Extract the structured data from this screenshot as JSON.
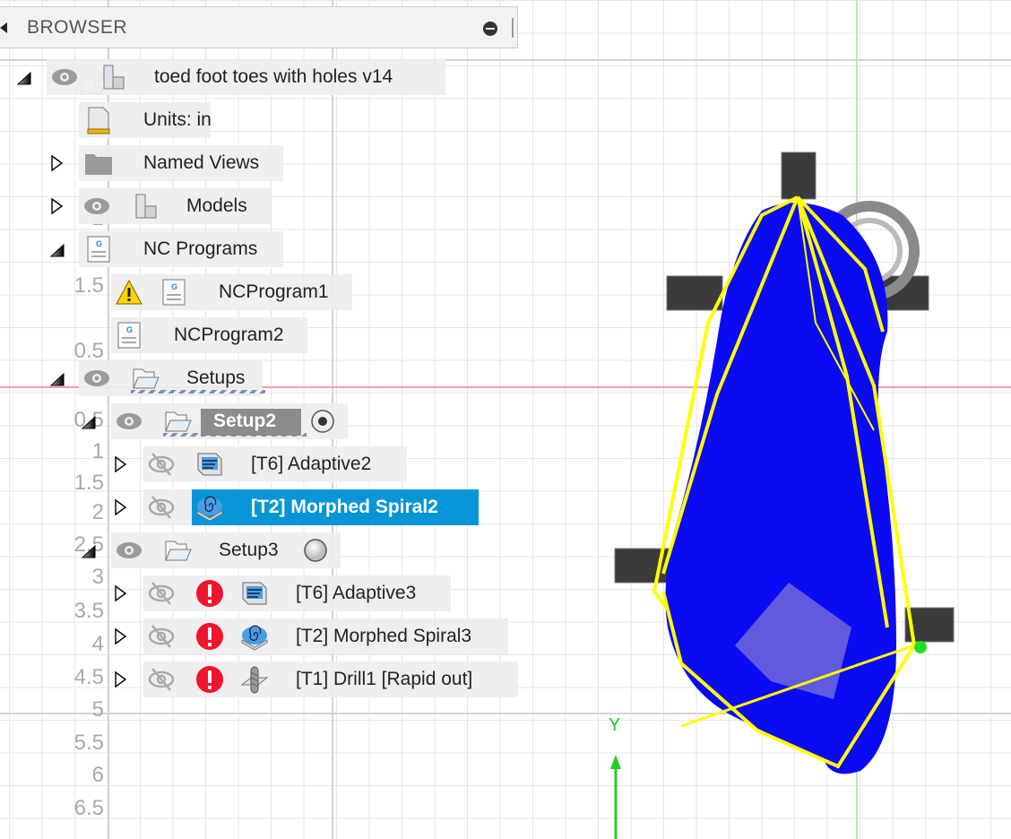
{
  "browser": {
    "title": "BROWSER",
    "tree": [
      {
        "id": "root",
        "label": "toed foot toes with holes v14",
        "expander": "expanded",
        "visibility": "visible",
        "icon": "component-icon"
      },
      {
        "id": "units",
        "label": "Units: in",
        "expander": "none",
        "icon": "units-document-icon"
      },
      {
        "id": "named-views",
        "label": "Named Views",
        "expander": "collapsed",
        "icon": "folder-icon"
      },
      {
        "id": "models",
        "label": "Models",
        "expander": "collapsed",
        "visibility": "visible",
        "icon": "component-icon"
      },
      {
        "id": "nc-programs",
        "label": "NC Programs",
        "expander": "expanded",
        "icon": "nc-program-icon"
      },
      {
        "id": "ncprogram1",
        "label": "NCProgram1",
        "expander": "none",
        "status": "warning",
        "icon": "nc-program-icon"
      },
      {
        "id": "ncprogram2",
        "label": "NCProgram2",
        "expander": "none",
        "icon": "nc-program-icon"
      },
      {
        "id": "setups",
        "label": "Setups",
        "expander": "expanded",
        "visibility": "visible",
        "icon": "setup-folder-icon"
      },
      {
        "id": "setup2",
        "label": "Setup2",
        "expander": "expanded",
        "visibility": "visible",
        "icon": "setup-folder-icon",
        "active": true,
        "radio": "selected"
      },
      {
        "id": "adaptive2",
        "label": "[T6] Adaptive2",
        "expander": "collapsed",
        "visibility": "hidden",
        "icon": "adaptive-icon"
      },
      {
        "id": "morphed-spiral2",
        "label": "[T2] Morphed Spiral2",
        "expander": "collapsed",
        "visibility": "hidden",
        "icon": "morphed-spiral-icon",
        "selected": true
      },
      {
        "id": "setup3",
        "label": "Setup3",
        "expander": "expanded",
        "visibility": "visible",
        "icon": "setup-folder-icon",
        "radio": "unselected"
      },
      {
        "id": "adaptive3",
        "label": "[T6] Adaptive3",
        "expander": "collapsed",
        "visibility": "hidden",
        "status": "error",
        "icon": "adaptive-icon"
      },
      {
        "id": "morphed-spiral3",
        "label": "[T2] Morphed Spiral3",
        "expander": "collapsed",
        "visibility": "hidden",
        "status": "error",
        "icon": "morphed-spiral-icon"
      },
      {
        "id": "drill1",
        "label": "[T1] Drill1 [Rapid out]",
        "expander": "collapsed",
        "visibility": "hidden",
        "status": "error",
        "icon": "drill-icon"
      }
    ]
  },
  "viewport": {
    "ruler_labels": [
      "4.5",
      "3",
      "2",
      "1.5",
      "0.5",
      "0.5",
      "1",
      "1.5",
      "2",
      "2.5",
      "3",
      "3.5",
      "4",
      "4.5",
      "5",
      "5.5",
      "6",
      "6.5"
    ],
    "axis_label": "Y",
    "colors": {
      "toolpath": "#0a0af5",
      "rapid": "#ffff00",
      "selection": "#0696d7",
      "x_axis": "#f08080",
      "y_axis": "#22cc22",
      "error": "#f0142d",
      "warning": "#ffd400"
    }
  }
}
